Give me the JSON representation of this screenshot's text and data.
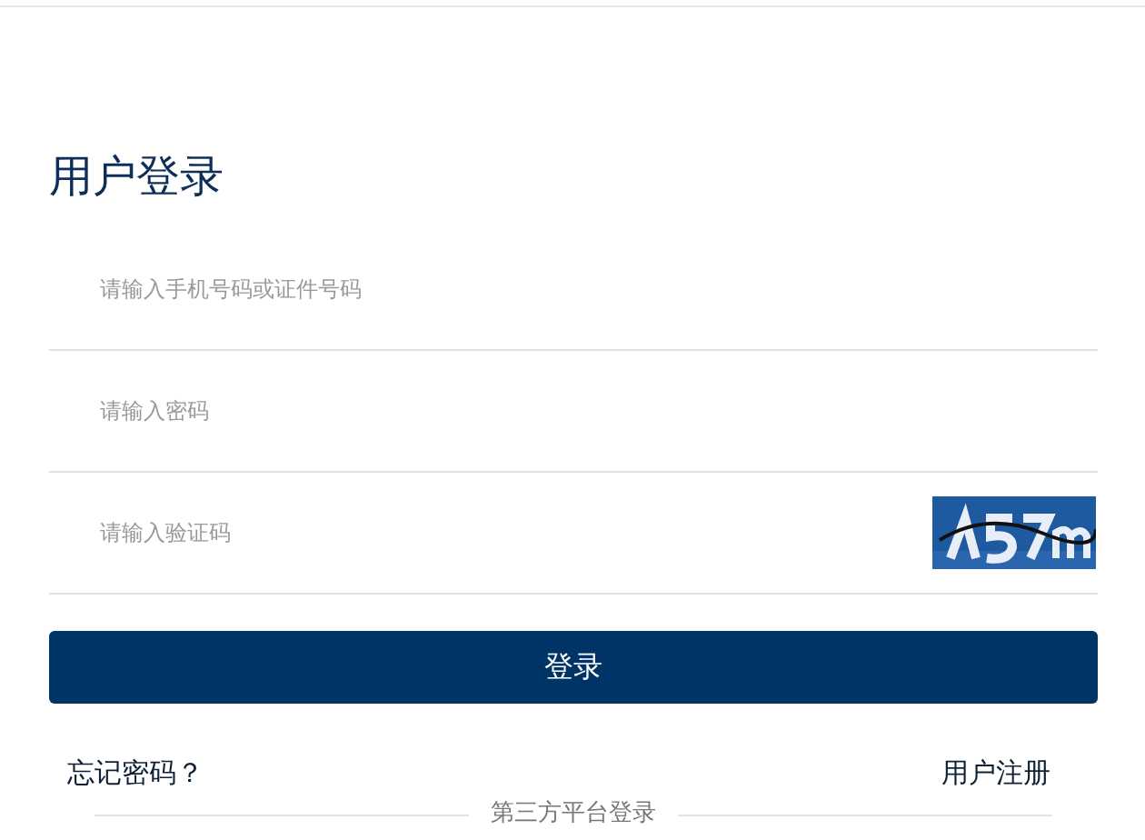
{
  "title": "用户登录",
  "fields": [
    {
      "kind": "text",
      "placeholder": "请输入手机号码或证件号码"
    },
    {
      "kind": "password",
      "placeholder": "请输入密码"
    },
    {
      "kind": "captcha",
      "placeholder": "请输入验证码"
    }
  ],
  "submit": "登录",
  "links": {
    "forgot": "忘记密码？",
    "register": "用户注册"
  },
  "third_party": "第三方平台登录"
}
